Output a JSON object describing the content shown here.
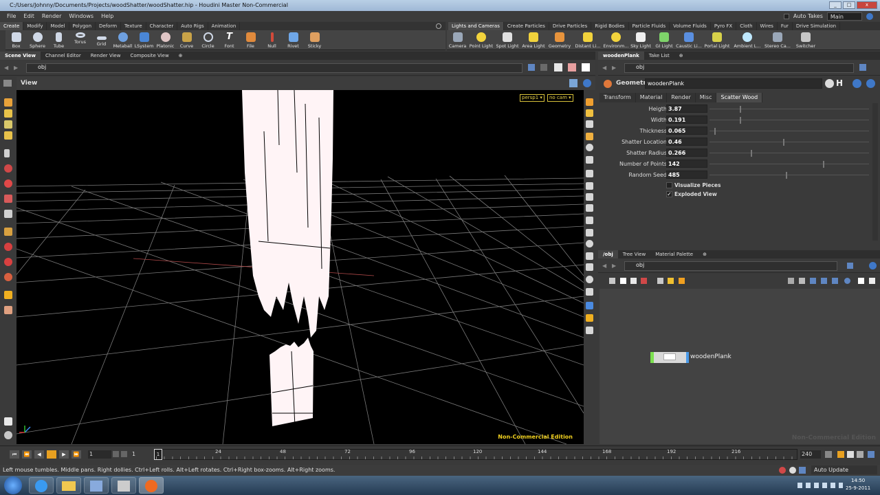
{
  "window": {
    "title": "C:/Users/Johnny/Documents/Projects/woodShatter/woodShatter.hip - Houdini Master Non-Commercial"
  },
  "menu": {
    "items": [
      "File",
      "Edit",
      "Render",
      "Windows",
      "Help"
    ],
    "auto_takes": "Auto Takes",
    "desktop": "Main"
  },
  "shelf_left": {
    "tabs": [
      "Create",
      "Modify",
      "Model",
      "Polygon",
      "Deform",
      "Texture",
      "Character",
      "Auto Rigs",
      "Animation"
    ],
    "tools": [
      "Box",
      "Sphere",
      "Tube",
      "Torus",
      "Grid",
      "Metaball",
      "LSystem",
      "Platonic ...",
      "Curve",
      "Circle",
      "Font",
      "File",
      "Null",
      "Rivet",
      "Sticky"
    ]
  },
  "shelf_right": {
    "tabs": [
      "Lights and Cameras",
      "Create Particles",
      "Drive Particles",
      "Rigid Bodies",
      "Particle Fluids",
      "Volume Fluids",
      "Pyro FX",
      "Cloth",
      "Wires",
      "Fur",
      "Drive Simulation"
    ],
    "tools": [
      "Camera",
      "Point Light",
      "Spot Light",
      "Area Light",
      "Geometry ...",
      "Environm...",
      "Sky Light",
      "GI Light",
      "Caustic Li...",
      "Portal Light",
      "Ambient L...",
      "Stereo Ca...",
      "Switcher"
    ],
    "extra": "Distant Li..."
  },
  "viewer_tabs": [
    "Scene View",
    "Channel Editor",
    "Render View",
    "Composite View"
  ],
  "viewer": {
    "path": "obj",
    "header": "View",
    "persp": "persp1",
    "cam": "no cam",
    "watermark": "Non-Commercial Edition"
  },
  "param_tabs_top": [
    "woodenPlank",
    "Take List"
  ],
  "params": {
    "path": "obj",
    "type": "Geometry",
    "node_name": "woodenPlank",
    "tabs": [
      "Transform",
      "Material",
      "Render",
      "Misc",
      "Scatter Wood"
    ],
    "rows": [
      {
        "label": "Heigth",
        "value": "3.87",
        "pos": 0.19
      },
      {
        "label": "Width",
        "value": "0.191",
        "pos": 0.19
      },
      {
        "label": "Thickness",
        "value": "0.065",
        "pos": 0.03
      },
      {
        "label": "Shatter Location",
        "value": "0.46",
        "pos": 0.46
      },
      {
        "label": "Shatter Radius",
        "value": "0.266",
        "pos": 0.26
      },
      {
        "label": "Number of Points",
        "value": "142",
        "pos": 0.71
      },
      {
        "label": "Random Seed",
        "value": "485",
        "pos": 0.48
      }
    ],
    "toggles": [
      {
        "label": "Visualize Pieces",
        "checked": false
      },
      {
        "label": "Exploded View",
        "checked": true
      }
    ]
  },
  "network_tabs": [
    "/obj",
    "Tree View",
    "Material Palette"
  ],
  "network": {
    "path": "obj",
    "node": "woodenPlank",
    "watermark": "Non-Commercial Edition"
  },
  "timeline": {
    "start": "1",
    "current": "1",
    "end": "240",
    "frame_marker": "1",
    "ticks": [
      "24",
      "48",
      "72",
      "96",
      "120",
      "144",
      "168",
      "192",
      "216"
    ]
  },
  "status": {
    "text": "Left mouse tumbles. Middle pans. Right dollies. Ctrl+Left rolls. Alt+Left rotates. Ctrl+Right box-zooms. Alt+Right zooms.",
    "update": "Auto Update"
  },
  "taskbar": {
    "time": "14:50",
    "date": "25-9-2011"
  }
}
